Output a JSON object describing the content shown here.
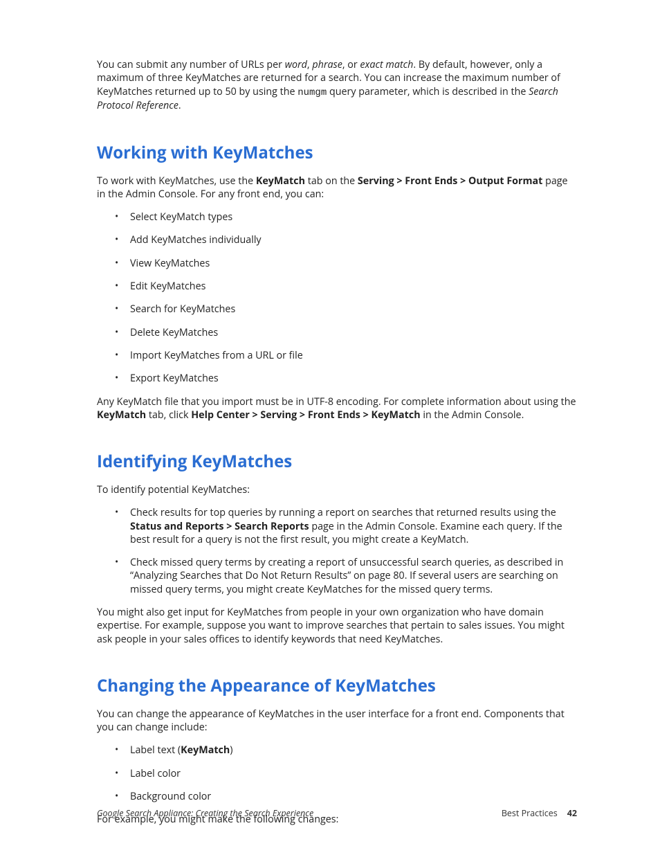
{
  "intro": {
    "p1_a": "You can submit any number of URLs per ",
    "p1_word": "word",
    "p1_b": ", ",
    "p1_phrase": "phrase",
    "p1_c": ", or ",
    "p1_exact": "exact match",
    "p1_d": ". By default, however, only a maximum of three KeyMatches are returned for a search. You can increase the maximum number of KeyMatches returned up to 50 by using the ",
    "p1_code": "numgm",
    "p1_e": " query parameter, which is described in the ",
    "p1_ref": "Search Protocol Reference",
    "p1_f": "."
  },
  "working": {
    "heading": "Working with KeyMatches",
    "p1_a": "To work with KeyMatches, use the ",
    "p1_b1": "KeyMatch",
    "p1_b": " tab on the ",
    "p1_b2": "Serving > Front Ends > Output Format",
    "p1_c": " page in the Admin Console. For any front end, you can:",
    "items": [
      "Select KeyMatch types",
      "Add KeyMatches individually",
      "View KeyMatches",
      "Edit KeyMatches",
      "Search for KeyMatches",
      "Delete KeyMatches",
      "Import KeyMatches from a URL or file",
      "Export KeyMatches"
    ],
    "p2_a": "Any KeyMatch file that you import must be in UTF-8 encoding. For complete information about using the ",
    "p2_b1": "KeyMatch",
    "p2_b": " tab, click ",
    "p2_b2": "Help Center > Serving > Front Ends > KeyMatch",
    "p2_c": " in the Admin Console."
  },
  "identifying": {
    "heading": "Identifying KeyMatches",
    "p1": "To identify potential KeyMatches:",
    "item1_a": "Check results for top queries by running a report on searches that returned results using the ",
    "item1_b": "Status and Reports > Search Reports",
    "item1_c": " page in the Admin Console. Examine each query. If the best result for a query is not the first result, you might create a KeyMatch.",
    "item2": "Check missed query terms by creating a report of unsuccessful search queries, as described in “Analyzing Searches that Do Not Return Results” on page 80. If several users are searching on missed query terms, you might create KeyMatches for the missed query terms.",
    "p2": "You might also get input for KeyMatches from people in your own organization who have domain expertise. For example, suppose you want to improve searches that pertain to sales issues. You might ask people in your sales offices to identify keywords that need KeyMatches."
  },
  "changing": {
    "heading": "Changing the Appearance of KeyMatches",
    "p1": "You can change the appearance of KeyMatches in the user interface for a front end. Components that you can change include:",
    "item1_a": "Label text (",
    "item1_b": "KeyMatch",
    "item1_c": ")",
    "item2": "Label color",
    "item3": "Background color",
    "p2": "For example, you might make the following changes:"
  },
  "footer": {
    "left": "Google Search Appliance: Creating the Search Experience",
    "right": "Best Practices",
    "page": "42"
  }
}
